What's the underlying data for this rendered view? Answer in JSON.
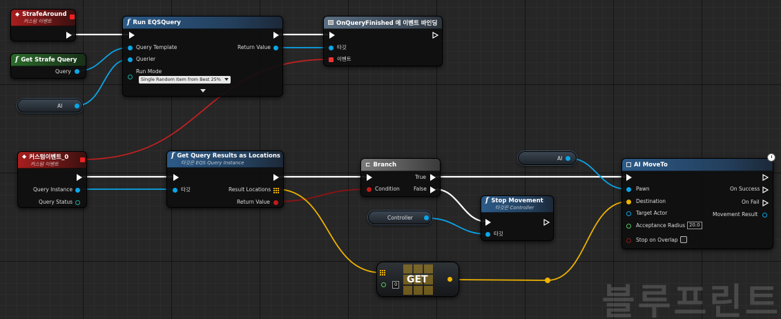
{
  "watermark": "블루프린트",
  "strafe_event": {
    "title": "StrafeAround",
    "subtitle": "커스텀 이벤트"
  },
  "get_strafe_query": {
    "title": "Get Strafe Query",
    "out_query": "Query"
  },
  "ai_var_1": {
    "label": "AI"
  },
  "run_eqs": {
    "title": "Run EQSQuery",
    "in_template": "Query Template",
    "in_querier": "Querier",
    "run_mode_label": "Run Mode",
    "run_mode_value": "Single Random Item from Best 25%",
    "out_return": "Return Value"
  },
  "bind_event": {
    "title": "OnQueryFinished 에 이벤트 바인딩",
    "in_target": "타깃",
    "in_event": "이벤트"
  },
  "custom_event_0": {
    "title": "커스텀이벤트_0",
    "subtitle": "커스텀 이벤트",
    "out_query_instance": "Query Instance",
    "out_query_status": "Query Status"
  },
  "get_query_results": {
    "title": "Get Query Results as Locations",
    "subtitle": "타깃은 EQS Query Instance",
    "in_target": "타깃",
    "out_result_locations": "Result Locations",
    "out_return": "Return Value"
  },
  "branch": {
    "title": "Branch",
    "in_condition": "Condition",
    "out_true": "True",
    "out_false": "False"
  },
  "stop_movement": {
    "title": "Stop Movement",
    "subtitle": "타깃은 Controller",
    "in_target": "타깃"
  },
  "controller_var": {
    "label": "Controller"
  },
  "ai_var_2": {
    "label": "AI"
  },
  "ai_moveto": {
    "title": "AI MoveTo",
    "in_pawn": "Pawn",
    "in_destination": "Destination",
    "in_target_actor": "Target Actor",
    "in_acceptance_radius": "Acceptance Radius",
    "acceptance_radius_value": "20.0",
    "in_stop_on_overlap": "Stop on Overlap",
    "out_on_success": "On Success",
    "out_on_fail": "On Fail",
    "out_movement_result": "Movement Result"
  },
  "get_node": {
    "label": "GET",
    "index_value": "0"
  },
  "colors": {
    "object_pin": "#0aa6e8",
    "vector_pin": "#f0b400",
    "delegate_pin": "#e22222",
    "exec_pin": "#ffffff",
    "bool_pin": "#8a1a1a"
  }
}
